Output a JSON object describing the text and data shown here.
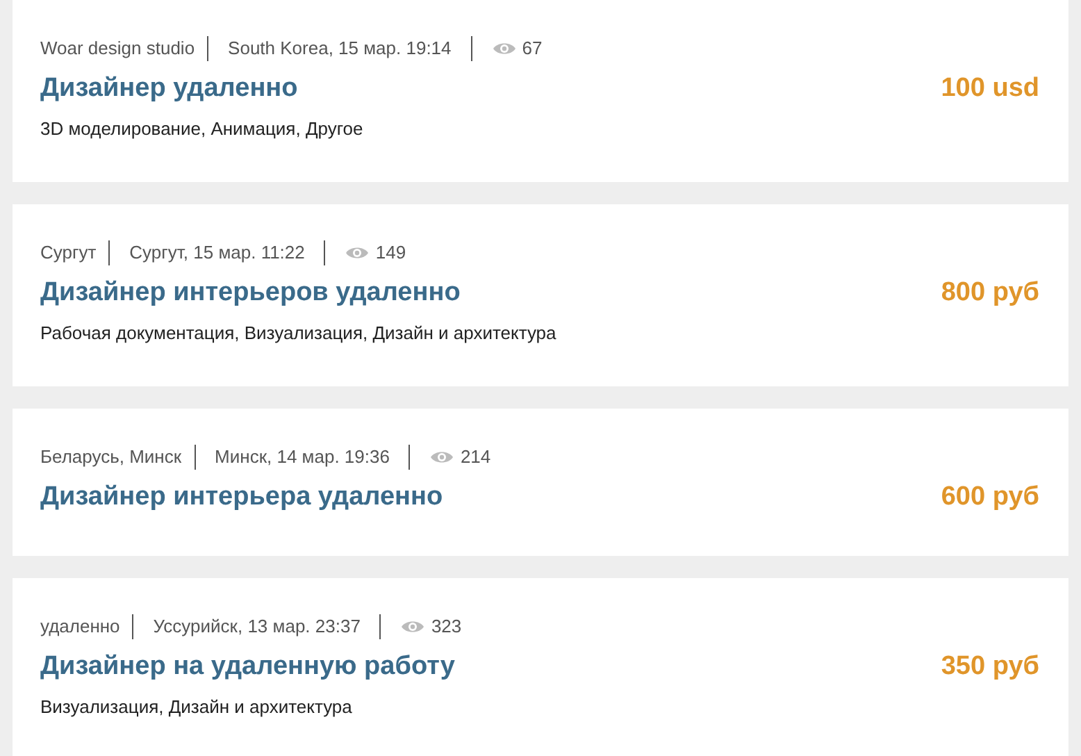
{
  "listings": [
    {
      "client": "Woar design studio",
      "location_date": "South Korea, 15 мар. 19:14",
      "views": "67",
      "title": "Дизайнер удаленно",
      "price": "100 usd",
      "tags": "3D моделирование, Анимация, Другое"
    },
    {
      "client": "Сургут",
      "location_date": "Сургут, 15 мар. 11:22",
      "views": "149",
      "title": "Дизайнер интерьеров удаленно",
      "price": "800 руб",
      "tags": "Рабочая документация, Визуализация, Дизайн и архитектура"
    },
    {
      "client": "Беларусь, Минск",
      "location_date": "Минск, 14 мар. 19:36",
      "views": "214",
      "title": "Дизайнер интерьера удаленно",
      "price": "600 руб"
    },
    {
      "client": "удаленно",
      "location_date": "Уссурийск, 13 мар. 23:37",
      "views": "323",
      "title": "Дизайнер на удаленную работу",
      "price": "350 руб",
      "tags": "Визуализация, Дизайн и архитектура"
    }
  ]
}
